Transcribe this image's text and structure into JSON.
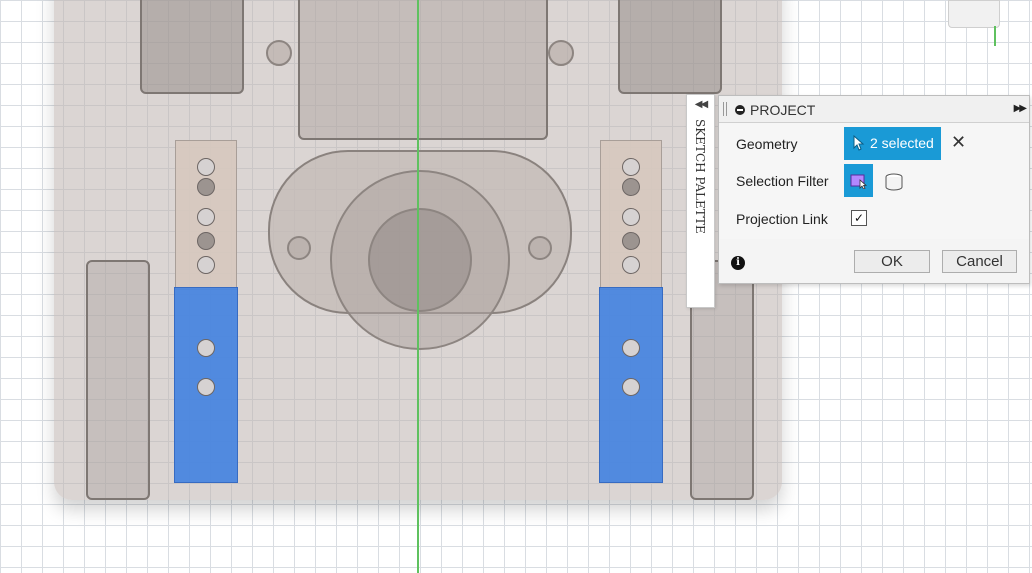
{
  "palette": {
    "label": "SKETCH PALETTE",
    "collapse_icon": "double-chevron-left-icon"
  },
  "dialog": {
    "title": "PROJECT",
    "expand_icon": "double-chevron-right-icon",
    "rows": {
      "geometry_label": "Geometry",
      "geometry_value": "2 selected",
      "selection_filter_label": "Selection Filter",
      "projection_link_label": "Projection Link",
      "projection_link_checked": true
    },
    "ok_label": "OK",
    "cancel_label": "Cancel"
  },
  "colors": {
    "accent": "#1a9ad6",
    "selection_highlight": "#4a86e0",
    "axis_green": "#5fc15f"
  }
}
